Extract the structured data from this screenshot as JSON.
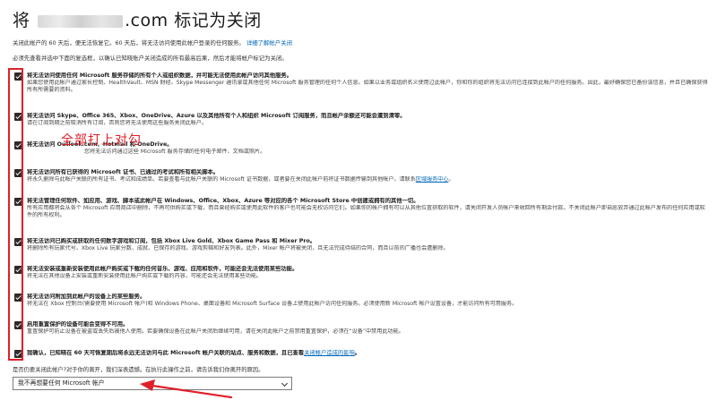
{
  "header": {
    "title_prefix": "将",
    "title_suffix": ".com 标记为关闭"
  },
  "intro": {
    "line1": "关闭此帐户的 60 天后，便无法恢复它。60 天后，将无法访问使用此帐户登录的任何服务。",
    "line1_link": "详细了解帐户关闭",
    "line2": "必须先查看并选中下面的复选框，以确认已知晓账户关闭造成的所有最高后果，然后才能将帐户标记为关闭。"
  },
  "items": [
    {
      "checked": true,
      "head": "将无法访问使用任何 Microsoft 服务存储的所有个人或组织数据，并可能无法使用此帐户访问其他服务。",
      "desc": "如果您使用此帐户通过家长控制、HealthVault、MSN 财经、Skype Messenger 通讯录或其他任何 Microsoft 服务管理的任何个人信息。如果以业务或组织名义使用过此帐户，你和你的组织将无法访问已连接到此帐户的任何服务。因此，最好确保您已备份该信息，并且已确保获得所有所需要的资料。"
    },
    {
      "checked": true,
      "head": "将无法访问 Skype、Office 365、Xbox、OneDrive、Azure 以及其他所有个人和组织 Microsoft 订阅服务，而且帐户余额还可能会遭到清零。",
      "desc": "请在订阅到期之前取消所有订阅，否则您将无法使用这些服务关闭此帐户。"
    },
    {
      "checked": true,
      "head": "将无法访问 Outlook.com、Hotmail 和 OneDrive。",
      "desc": "您将无法访问通过这些 Microsoft 服务存储的任何电子邮件、文档或照片。"
    },
    {
      "checked": true,
      "head": "将无法访问所有已获得的 Microsoft 证书、已通过的考试和所有相关脚本。",
      "desc": "将永久删除与此帐户关联的所有证书、考试和成绩单。若要查看与此帐户关联的 Microsoft 证书数据，或者要在关闭此帐户前将证书数据传输到其他帐户，请联系",
      "desc_link": "区域服务中心",
      "desc_end": "。"
    },
    {
      "checked": true,
      "head": "将无法管理任何软件、如应用、游戏、脚本或此帐户在 Windows、Office、Xbox、Azure 等对应的各个 Microsoft Store 中创建或拥有的其他一切。",
      "desc": "所有应用都将会从各个 Microsoft 应用商店中删除，不再可供购买或下载，而且曾经购买或使用此软件的客户也可能会无权访问它们。如果你的帐户拥有可以从其他位置获取的软件，请关闭开发人员帐户来收回所有剩余付款。不关闭此帐户即自愿放弃通过此帐户发布的任何应用或软件的所有权利。"
    },
    {
      "checked": true,
      "head": "将无法访问已购买或获取的任何数字游戏和订阅，包括 Xbox Live Gold、Xbox Game Pass 和 Mixer Pro。",
      "desc": "将删除所有玩家代号、Xbox Live 玩家分数、成就、已保存的游戏、游戏剪辑和好友列表。此外，Mixer 帐户将被关闭，且无法完成待结的合同，而且以前的广播也会遭删除。"
    },
    {
      "checked": true,
      "head": "将无法安装或重新安装使用此帐户购买或下载的任何音乐、游戏、应用和软件，可能还会无法使用某些功能。",
      "desc": "将无法在其他设备上安装或重新安装使用此帐户购买或下载的内容，可能还会无法使用某些功能。"
    },
    {
      "checked": true,
      "head": "将无法访问附加到此帐户的设备上的某些服务。",
      "desc": "将无法在 Xbox 控制台(需要使用 Microsoft 帐户)和 Windows Phone、桌面设备和 Microsoft Surface 设备上使用此帐户访问任何服务。必须使用新 Microsoft 帐户设置设备，才能访问所有可用服务。"
    },
    {
      "checked": true,
      "head": "启用重置保护的设备可能会变得不可用。",
      "desc": "重置保护可防止设备在被盗或丢失后被他人使用。若要确保设备在此帐户关闭后继续可用，请在关闭此帐户之前禁用重置保护，必须在“设备”中禁用此功能。"
    },
    {
      "checked": true,
      "head": "我确认，已知晓在 60 天可恢复期后将永远无法访问与此 Microsoft 帐户关联的站点、服务和数据，且已查看",
      "head_link": "关闭帐户造成的影响",
      "head_end": "。"
    }
  ],
  "reason": {
    "question": "是否仍要关闭此帐户?对于你的离开，我们深表遗憾。在执行此操作之前，请告诉我们你离开的原因。",
    "selected": "我不再想要任何 Microsoft 帐户"
  },
  "annotation": {
    "text": "全部打上对勾",
    "color": "#e0202a"
  }
}
